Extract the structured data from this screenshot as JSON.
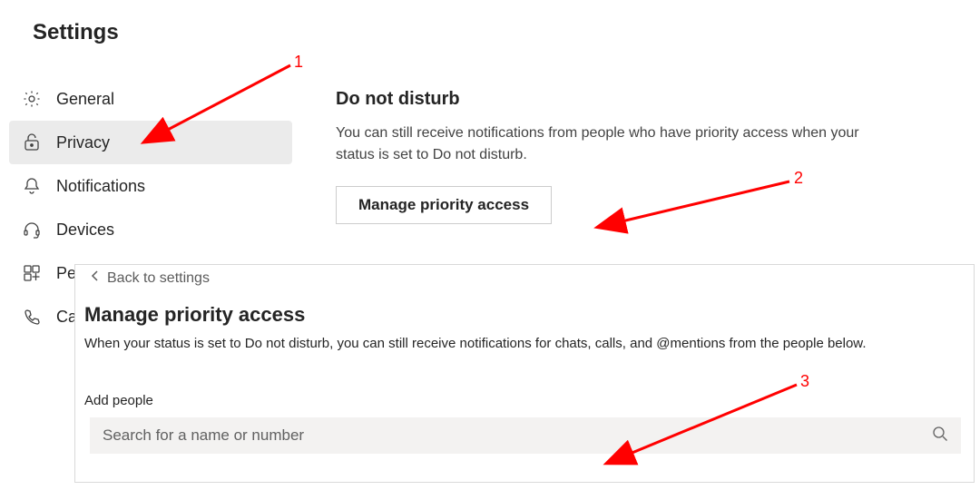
{
  "page_title": "Settings",
  "sidebar": {
    "items": [
      {
        "label": "General"
      },
      {
        "label": "Privacy"
      },
      {
        "label": "Notifications"
      },
      {
        "label": "Devices"
      },
      {
        "label": "Pe"
      },
      {
        "label": "Ca"
      }
    ]
  },
  "main": {
    "section_title": "Do not disturb",
    "section_desc": "You can still receive notifications from people who have priority access when your status is set to Do not disturb.",
    "button_label": "Manage priority access"
  },
  "back_link": "Back to settings",
  "overlay": {
    "title": "Manage priority access",
    "desc": "When your status is set to Do not disturb, you can still receive notifications for chats, calls, and @mentions from the people below.",
    "add_label": "Add people",
    "search_placeholder": "Search for a name or number"
  },
  "annotations": {
    "a1": "1",
    "a2": "2",
    "a3": "3"
  }
}
